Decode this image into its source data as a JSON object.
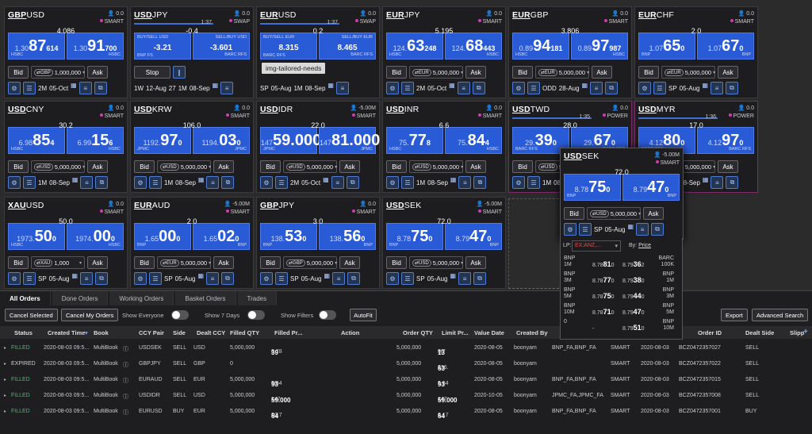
{
  "tiles": [
    {
      "base": "GBP",
      "quote": "USD",
      "user_val": "0.0",
      "route": "SMART",
      "spread": "4.086",
      "bid_pre": "1.30",
      "bid_big": "87",
      "bid_pip": "614",
      "ask_pre": "1.30",
      "ask_big": "91",
      "ask_pip": "700",
      "bid_lp": "HSBC",
      "ask_lp": "HSBC",
      "ccy": "GBP",
      "amount": "1,000,000",
      "tenor": "2M",
      "date": "05-Oct",
      "pink": false
    },
    {
      "base": "USD",
      "quote": "JPY",
      "user_val": "0.0",
      "route": "SWAP",
      "timer": "1:37",
      "spread": "-0.4",
      "swap": true,
      "bid_title": "BUY/SELL USD",
      "ask_title": "SELL/BUY USD",
      "bid_val": "-3.21",
      "ask_val": "-3.601",
      "bid_lp": "BNP FS",
      "ask_lp": "BARC RFS",
      "near_tenor": "1W",
      "near_date": "12-Aug",
      "near_days": "27",
      "far_tenor": "1M",
      "far_date": "08-Sep",
      "stop_label": "Stop"
    },
    {
      "base": "EUR",
      "quote": "USD",
      "user_val": "0.0",
      "route": "SWAP",
      "timer": "1:37",
      "spread": "0.2",
      "swap": true,
      "bid_title": "BUY/SELL EUR",
      "ask_title": "SELL/BUY EUR",
      "bid_val": "8.315",
      "ask_val": "8.465",
      "bid_lp": "BARC RFS",
      "ask_lp": "BARC RFS",
      "near_tenor": "SP",
      "near_date": "05-Aug",
      "far_tenor": "1M",
      "far_date": "08-Sep"
    },
    {
      "base": "EUR",
      "quote": "JPY",
      "user_val": "0.0",
      "route": "SMART",
      "spread": "5.195",
      "bid_pre": "124.",
      "bid_big": "63",
      "bid_pip": "248",
      "ask_pre": "124.",
      "ask_big": "68",
      "ask_pip": "443",
      "bid_lp": "HSBC",
      "ask_lp": "HSBC",
      "ccy": "EUR",
      "amount": "5,000,000",
      "tenor": "2M",
      "date": "05-Oct"
    },
    {
      "base": "EUR",
      "quote": "GBP",
      "user_val": "0.0",
      "route": "SMART",
      "spread": "3.806",
      "bid_pre": "0.89",
      "bid_big": "94",
      "bid_pip": "181",
      "ask_pre": "0.89",
      "ask_big": "97",
      "ask_pip": "987",
      "bid_lp": "HSBC",
      "ask_lp": "HSBC",
      "ccy": "EUR",
      "amount": "5,000,000",
      "tenor": "ODD",
      "date": "28-Aug"
    },
    {
      "base": "EUR",
      "quote": "CHF",
      "user_val": "0.0",
      "route": "SMART",
      "spread": "2.0",
      "bid_pre": "1.07",
      "bid_big": "65",
      "bid_pip": "0",
      "ask_pre": "1.07",
      "ask_big": "67",
      "ask_pip": "0",
      "bid_lp": "BNP",
      "ask_lp": "BNP",
      "ccy": "EUR",
      "amount": "5,000,000",
      "tenor": "SP",
      "date": "05-Aug"
    },
    {
      "base": "USD",
      "quote": "CNY",
      "user_val": "0.0",
      "route": "SMART",
      "spread": "30.2",
      "bid_pre": "6.98",
      "bid_big": "85",
      "bid_pip": "4",
      "ask_pre": "6.99",
      "ask_big": "15",
      "ask_pip": "6",
      "bid_lp": "HSBC",
      "ask_lp": "HSBC",
      "ccy": "USD",
      "amount": "5,000,000",
      "tenor": "1M",
      "date": "08-Sep"
    },
    {
      "base": "USD",
      "quote": "KRW",
      "user_val": "0.0",
      "route": "SMART",
      "spread": "106.0",
      "bid_pre": "1192.",
      "bid_big": "97",
      "bid_pip": "0",
      "ask_pre": "1194.",
      "ask_big": "03",
      "ask_pip": "0",
      "bid_lp": "JPMC",
      "ask_lp": "JPMC",
      "ccy": "USD",
      "amount": "5,000,000",
      "tenor": "1M",
      "date": "08-Sep"
    },
    {
      "base": "USD",
      "quote": "IDR",
      "user_val": "-5.00M",
      "route": "SMART",
      "spread": "22.0",
      "bid_pre": "147",
      "bid_big": "59.000",
      "bid_pip": "",
      "ask_pre": "147",
      "ask_big": "81.000",
      "ask_pip": "",
      "bid_lp": "JPMC",
      "ask_lp": "JPMC",
      "ccy": "USD",
      "amount": "5,000,000",
      "tenor": "2M",
      "date": "05-Oct"
    },
    {
      "base": "USD",
      "quote": "INR",
      "user_val": "0.0",
      "route": "SMART",
      "spread": "6.6",
      "bid_pre": "75.",
      "bid_big": "77",
      "bid_pip": "8",
      "ask_pre": "75.",
      "ask_big": "84",
      "ask_pip": "4",
      "bid_lp": "HSBC",
      "ask_lp": "HSBC",
      "ccy": "USD",
      "amount": "5,000,000",
      "tenor": "1M",
      "date": "08-Sep"
    },
    {
      "base": "USD",
      "quote": "TWD",
      "user_val": "0.0",
      "route": "POWER",
      "timer": "1:35",
      "spread": "28.0",
      "bid_pre": "29.",
      "bid_big": "39",
      "bid_pip": "0",
      "ask_pre": "29.",
      "ask_big": "67",
      "ask_pip": "0",
      "bid_lp": "BARC RFS",
      "ask_lp": "BARC RFS",
      "ccy": "USD",
      "amount": "5,000,000",
      "tenor": "1M",
      "date": "08-Sep",
      "pink": true
    },
    {
      "base": "USD",
      "quote": "MYR",
      "user_val": "0.0",
      "route": "POWER",
      "timer": "1:36",
      "spread": "17.0",
      "bid_pre": "4.12",
      "bid_big": "80",
      "bid_pip": "0",
      "ask_pre": "4.12",
      "ask_big": "97",
      "ask_pip": "0",
      "bid_lp": "BARC RFS",
      "ask_lp": "BARC RFS",
      "ccy": "USD",
      "amount": "5,000,000",
      "tenor": "1M",
      "date": "08-Sep",
      "pink": true
    },
    {
      "base": "XAU",
      "quote": "USD",
      "user_val": "0.0",
      "route": "SMART",
      "spread": "50.0",
      "bid_pre": "1973.",
      "bid_big": "50",
      "bid_pip": "0",
      "ask_pre": "1974.",
      "ask_big": "00",
      "ask_pip": "0",
      "bid_lp": "HSBC",
      "ask_lp": "HSBC",
      "ccy": "XAU",
      "amount": "1,000",
      "tenor": "SP",
      "date": "05-Aug"
    },
    {
      "base": "EUR",
      "quote": "AUD",
      "user_val": "-5.00M",
      "route": "SMART",
      "spread": "2.0",
      "bid_pre": "1.65",
      "bid_big": "00",
      "bid_pip": "0",
      "ask_pre": "1.65",
      "ask_big": "02",
      "ask_pip": "0",
      "bid_lp": "BNP",
      "ask_lp": "BNP",
      "ccy": "EUR",
      "amount": "5,000,000",
      "tenor": "SP",
      "date": "05-Aug"
    },
    {
      "base": "GBP",
      "quote": "JPY",
      "user_val": "0.0",
      "route": "SMART",
      "spread": "3.0",
      "bid_pre": "138.",
      "bid_big": "53",
      "bid_pip": "0",
      "ask_pre": "138.",
      "ask_big": "56",
      "ask_pip": "0",
      "bid_lp": "BNP",
      "ask_lp": "BNP",
      "ccy": "GBP",
      "amount": "5,000,000",
      "tenor": "SP",
      "date": "05-Aug"
    },
    {
      "base": "USD",
      "quote": "SEK",
      "user_val": "-5.00M",
      "route": "SMART",
      "spread": "72.0",
      "bid_pre": "8.78",
      "bid_big": "75",
      "bid_pip": "0",
      "ask_pre": "8.79",
      "ask_big": "47",
      "ask_pip": "0",
      "bid_lp": "BNP",
      "ask_lp": "BNP",
      "ccy": "USD",
      "amount": "5,000,000",
      "tenor": "SP",
      "date": "05-Aug"
    }
  ],
  "popup": {
    "base": "USD",
    "quote": "SEK",
    "user_val": "-5.00M",
    "route": "SMART",
    "spread": "72.0",
    "bid_pre": "8.78",
    "bid_big": "75",
    "bid_pip": "0",
    "ask_pre": "8.79",
    "ask_big": "47",
    "ask_pip": "0",
    "bid_lp": "BNP",
    "ask_lp": "BNP",
    "ccy": "USD",
    "amount": "5,000,000",
    "tenor": "SP",
    "date": "05-Aug"
  },
  "labels": {
    "bid": "Bid",
    "ask": "Ask",
    "stop": "Stop",
    "lp": "LP:",
    "lp_value": "EX:ANZ,...",
    "by": "By:",
    "by_value": "Price",
    "tooltip": "img-tailored-needs"
  },
  "depth": [
    {
      "lp": "BNP",
      "size": "1M",
      "bid": "8.78",
      "bid_big": "81",
      "bid_pip": "0",
      "ask": "8.79",
      "ask_big": "36",
      "ask_pip": "2",
      "rlp": "BARC",
      "rsize": "100K"
    },
    {
      "lp": "BNP",
      "size": "3M",
      "bid": "8.78",
      "bid_big": "77",
      "bid_pip": "0",
      "ask": "8.79",
      "ask_big": "38",
      "ask_pip": "0",
      "rlp": "BNP",
      "rsize": "1M"
    },
    {
      "lp": "BNP",
      "size": "5M",
      "bid": "8.78",
      "bid_big": "75",
      "bid_pip": "0",
      "ask": "8.79",
      "ask_big": "44",
      "ask_pip": "0",
      "rlp": "BNP",
      "rsize": "3M"
    },
    {
      "lp": "BNP",
      "size": "10M",
      "bid": "8.78",
      "bid_big": "71",
      "bid_pip": "0",
      "ask": "8.79",
      "ask_big": "47",
      "ask_pip": "0",
      "rlp": "BNP",
      "rsize": "5M"
    },
    {
      "lp": "",
      "size": "0",
      "bid": "-",
      "bid_big": "",
      "bid_pip": "",
      "ask": "8.79",
      "ask_big": "51",
      "ask_pip": "0",
      "rlp": "BNP",
      "rsize": "10M"
    }
  ],
  "orders": {
    "tabs": [
      "All Orders",
      "Done Orders",
      "Working Orders",
      "Basket Orders",
      "Trades"
    ],
    "cancel_selected": "Cancel Selected",
    "cancel_my": "Cancel My Orders",
    "show_everyone": "Show Everyone",
    "show_7days": "Show 7 Days",
    "show_filters": "Show Filters",
    "autofit": "AutoFit",
    "export": "Export",
    "advanced_search": "Advanced Search",
    "columns": [
      "Status",
      "Created Time",
      "Book",
      "CCY Pair",
      "Side",
      "Dealt CCY",
      "Filled QTY",
      "Filled Pr...",
      "Action",
      "Order QTY",
      "Limit Pr...",
      "Value Date",
      "Created By",
      "",
      "",
      "",
      "Order ID",
      "Dealt Side",
      "Slipp"
    ],
    "rows": [
      {
        "status": "FILLED",
        "time": "2020-08-03 09:5...",
        "book": "MultiBook",
        "pair": "USDSEK",
        "side": "SELL",
        "ccy": "USD",
        "fqty": "5,000,000",
        "fpr_pre": "8.78",
        "fpr_big": "39",
        "fpr_pip": "0",
        "oqty": "5,000,000",
        "lpr_pre": "8.7",
        "lpr_big": "13",
        "lpr_pip": "90",
        "vdate": "2020-08-05",
        "by": "boonyam",
        "lps": "BNP_FA,BNP_FA",
        "route": "SMART",
        "date": "2020-08-03",
        "id": "BCZ0472357027",
        "dside": "SELL"
      },
      {
        "status": "EXPIRED",
        "time": "2020-08-03 09:5...",
        "book": "MultiBook",
        "pair": "GBPJPY",
        "side": "SELL",
        "ccy": "GBP",
        "fqty": "0",
        "fpr_pre": "",
        "fpr_big": "",
        "fpr_pip": "",
        "oqty": "5,000,000",
        "lpr_pre": "136.",
        "lpr_big": "63",
        "lpr_pip": "0",
        "vdate": "2020-08-05",
        "by": "boonyam",
        "lps": "",
        "route": "SMART",
        "date": "2020-08-03",
        "id": "BCZ0472357022",
        "dside": "SELL"
      },
      {
        "status": "FILLED",
        "time": "2020-08-03 09:5...",
        "book": "MultiBook",
        "pair": "EURAUD",
        "side": "SELL",
        "ccy": "EUR",
        "fqty": "5,000,000",
        "fpr_pre": "1.64",
        "fpr_big": "93",
        "fpr_pip": "00",
        "oqty": "5,000,000",
        "lpr_pre": "1.64",
        "lpr_big": "93",
        "lpr_pip": "0",
        "vdate": "2020-08-05",
        "by": "boonyam",
        "lps": "BNP_FA,BNP_FA",
        "route": "SMART",
        "date": "2020-08-03",
        "id": "BCZ0472357015",
        "dside": "SELL"
      },
      {
        "status": "FILLED",
        "time": "2020-08-03 09:5...",
        "book": "MultiBook",
        "pair": "USDIDR",
        "side": "SELL",
        "ccy": "USD",
        "fqty": "5,000,000",
        "fpr_pre": "147",
        "fpr_big": "59.000",
        "fpr_pip": "",
        "oqty": "5,000,000",
        "lpr_pre": "147",
        "lpr_big": "59.000",
        "lpr_pip": "",
        "vdate": "2020-10-05",
        "by": "boonyam",
        "lps": "JPMC_FA,JPMC_FA",
        "route": "SMART",
        "date": "2020-08-03",
        "id": "BCZ0472357008",
        "dside": "SELL"
      },
      {
        "status": "FILLED",
        "time": "2020-08-03 09:5...",
        "book": "MultiBook",
        "pair": "EURUSD",
        "side": "BUY",
        "ccy": "EUR",
        "fqty": "5,000,000",
        "fpr_pre": "1.17",
        "fpr_big": "64",
        "fpr_pip": "00",
        "oqty": "5,000,000",
        "lpr_pre": "1.17",
        "lpr_big": "64",
        "lpr_pip": "0",
        "vdate": "2020-08-05",
        "by": "boonyam",
        "lps": "BNP_FA,BNP_FA",
        "route": "SMART",
        "date": "2020-08-03",
        "id": "BCZ0472357001",
        "dside": "BUY"
      }
    ]
  },
  "colors": {
    "accent": "#2a5bd7",
    "filled": "#35c46b",
    "route_dot": "#d03cb4",
    "pink_border": "#7c2a6a"
  }
}
